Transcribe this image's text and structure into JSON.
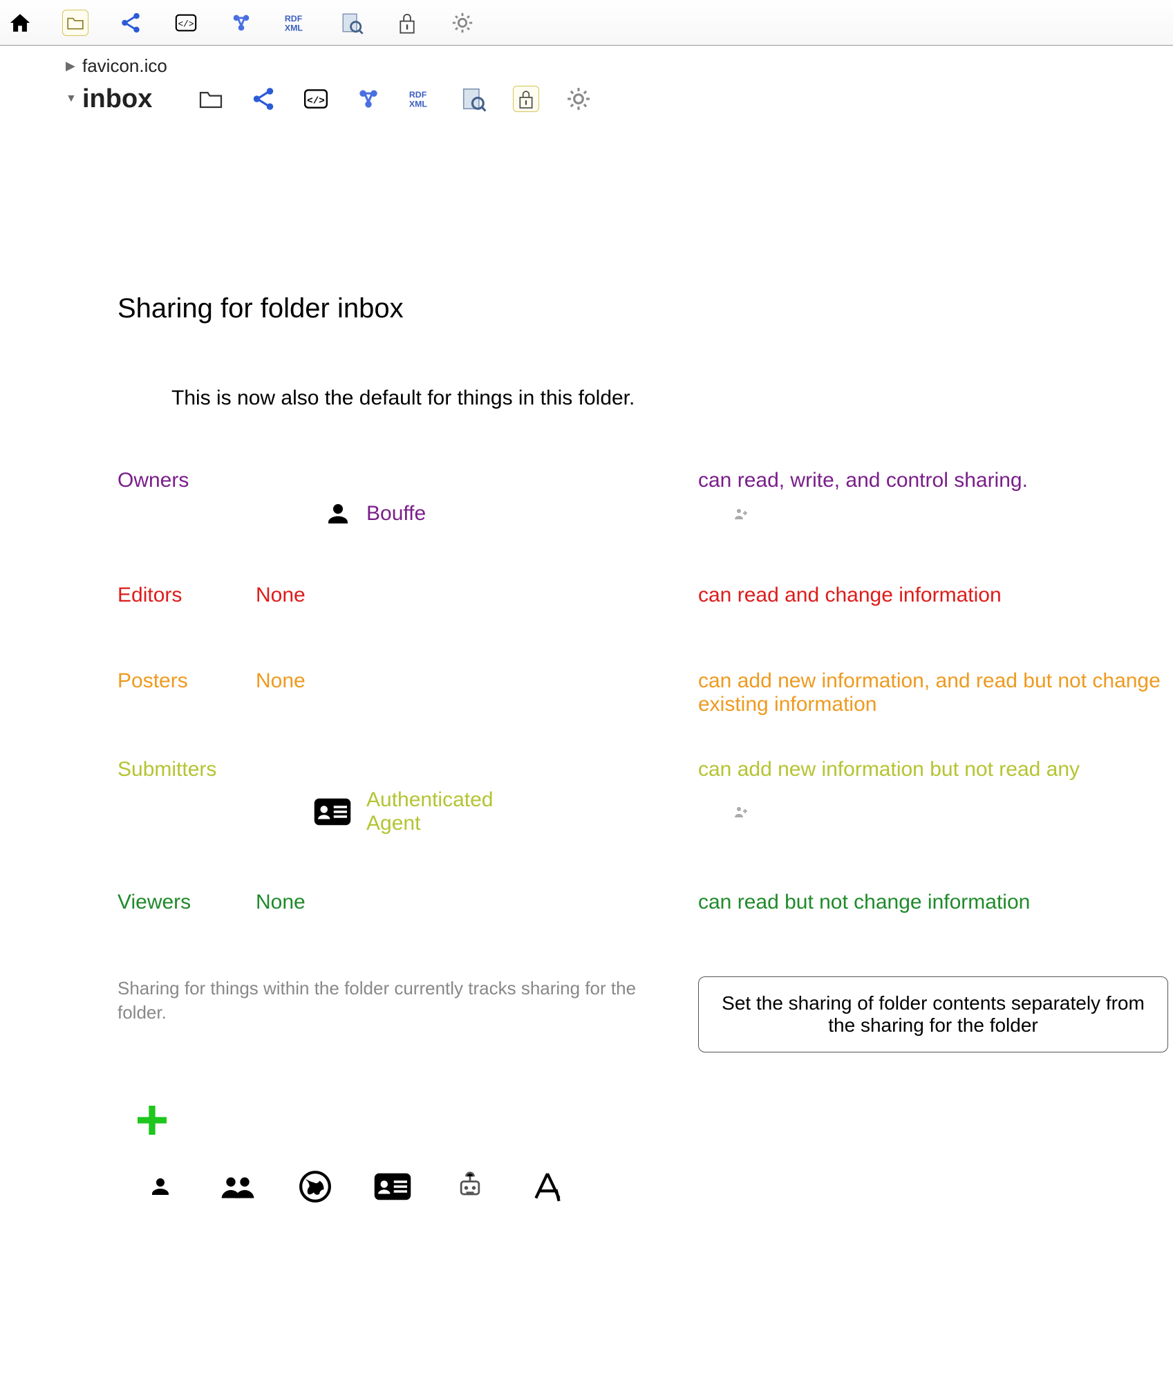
{
  "tree": {
    "items": [
      {
        "label": "favicon.ico",
        "expanded": false
      },
      {
        "label": "inbox",
        "expanded": true,
        "bold": true
      }
    ]
  },
  "page": {
    "title": "Sharing for folder inbox",
    "subtitle": "This is now also the default for things in this folder."
  },
  "roles": {
    "owners": {
      "label": "Owners",
      "desc": "can read, write, and control sharing.",
      "agents": [
        {
          "name": "Bouffe",
          "iconType": "person"
        }
      ]
    },
    "editors": {
      "label": "Editors",
      "none": "None",
      "desc": "can read and change information"
    },
    "posters": {
      "label": "Posters",
      "none": "None",
      "desc": "can add new information, and read but not change existing information"
    },
    "submitters": {
      "label": "Submitters",
      "desc": "can add new information but not read any",
      "agents": [
        {
          "name": "Authenticated Agent",
          "iconType": "card"
        }
      ]
    },
    "viewers": {
      "label": "Viewers",
      "none": "None",
      "desc": "can read but not change information"
    }
  },
  "tracking": {
    "text": "Sharing for things within the folder currently tracks sharing for the folder.",
    "button": "Set the sharing of folder contents separately from the sharing for the folder"
  },
  "icons": {
    "home": "home-icon",
    "folder": "folder-icon",
    "share": "share-icon",
    "code": "code-icon",
    "molecule": "molecule-icon",
    "rdfxml": "rdfxml-icon",
    "search": "search-icon",
    "lock": "lock-icon",
    "gear": "gear-icon",
    "addperson": "add-person-icon",
    "plus": "plus-icon",
    "person": "person-icon",
    "group": "group-icon",
    "globe": "globe-icon",
    "card": "card-icon",
    "robot": "robot-icon",
    "app": "app-icon"
  }
}
